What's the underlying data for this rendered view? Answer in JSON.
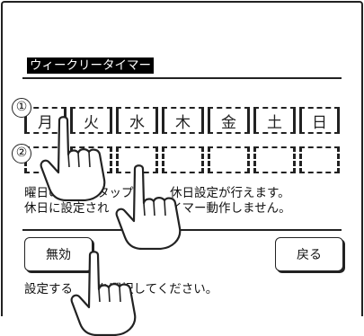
{
  "screen": {
    "title": "ウィークリータイマー",
    "row_markers": [
      "①",
      "②"
    ],
    "days": [
      "月",
      "火",
      "水",
      "木",
      "金",
      "土",
      "日"
    ],
    "instruction_line1": "曜日の　　をタップ　　　休日設定が行えます。",
    "instruction_line2": "休日に設定され　　　　タイマー動作しません。",
    "disable_button_label": "無効",
    "back_button_label": "戻る",
    "footer_message": "設定する　　を選択してください。"
  }
}
